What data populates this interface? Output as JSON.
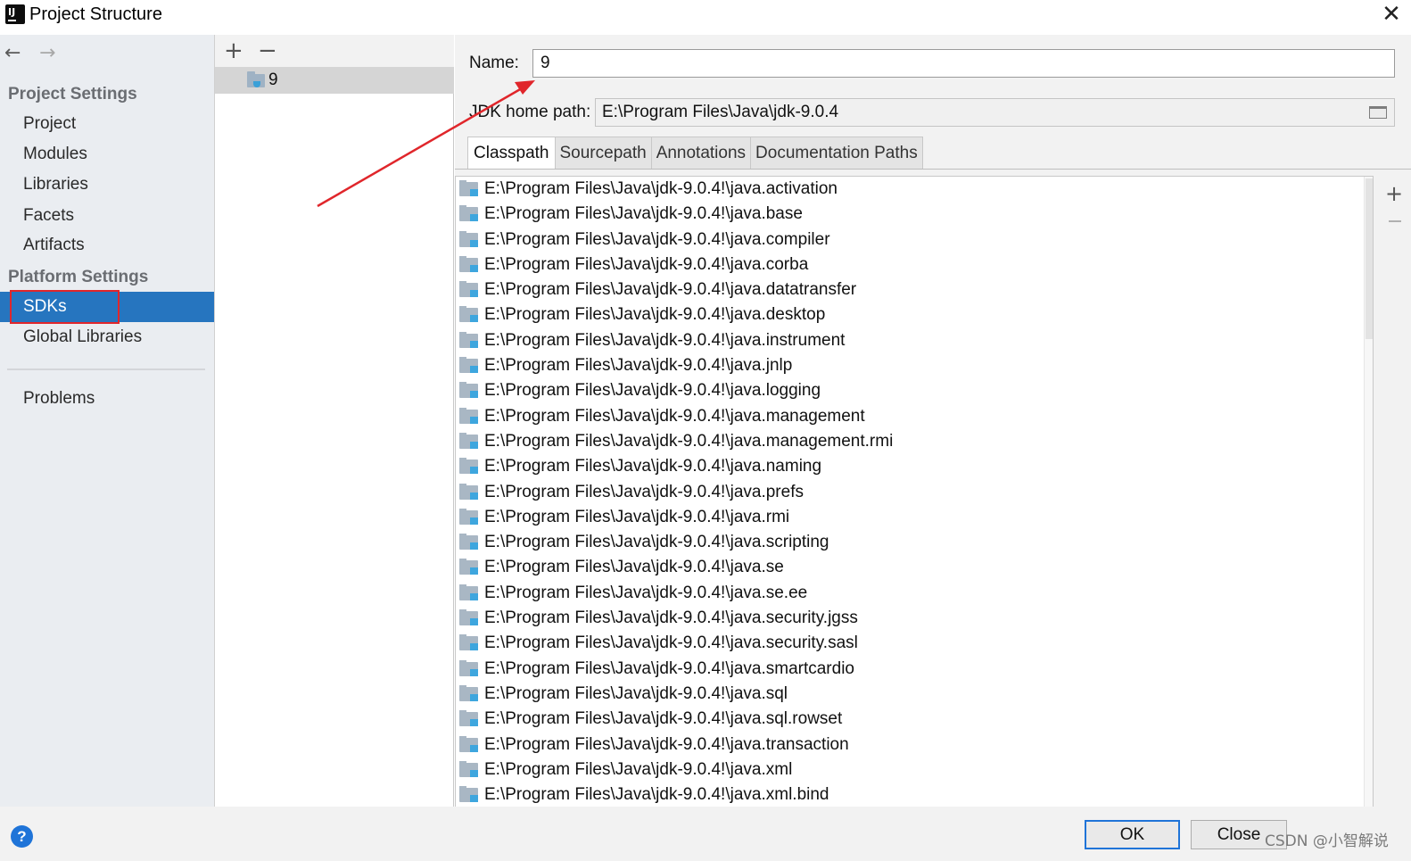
{
  "window": {
    "title": "Project Structure",
    "app_icon_letters": "IJ",
    "close_glyph": "✕"
  },
  "nav": {
    "back_glyph": "←",
    "forward_glyph": "→"
  },
  "sidebar": {
    "project_settings_header": "Project Settings",
    "project_items": [
      "Project",
      "Modules",
      "Libraries",
      "Facets",
      "Artifacts"
    ],
    "platform_settings_header": "Platform Settings",
    "platform_items": [
      "SDKs",
      "Global Libraries"
    ],
    "selected_item": "SDKs",
    "problems_label": "Problems"
  },
  "sdk_list": {
    "add_glyph": "+",
    "remove_glyph": "−",
    "items": [
      "9"
    ]
  },
  "details": {
    "name_label": "Name:",
    "name_value": "9",
    "jdk_path_label": "JDK home path:",
    "jdk_path_value": "E:\\Program Files\\Java\\jdk-9.0.4",
    "tabs": [
      "Classpath",
      "Sourcepath",
      "Annotations",
      "Documentation Paths"
    ],
    "active_tab": "Classpath",
    "side_add_glyph": "+",
    "classpath_entries": [
      "E:\\Program Files\\Java\\jdk-9.0.4!\\java.activation",
      "E:\\Program Files\\Java\\jdk-9.0.4!\\java.base",
      "E:\\Program Files\\Java\\jdk-9.0.4!\\java.compiler",
      "E:\\Program Files\\Java\\jdk-9.0.4!\\java.corba",
      "E:\\Program Files\\Java\\jdk-9.0.4!\\java.datatransfer",
      "E:\\Program Files\\Java\\jdk-9.0.4!\\java.desktop",
      "E:\\Program Files\\Java\\jdk-9.0.4!\\java.instrument",
      "E:\\Program Files\\Java\\jdk-9.0.4!\\java.jnlp",
      "E:\\Program Files\\Java\\jdk-9.0.4!\\java.logging",
      "E:\\Program Files\\Java\\jdk-9.0.4!\\java.management",
      "E:\\Program Files\\Java\\jdk-9.0.4!\\java.management.rmi",
      "E:\\Program Files\\Java\\jdk-9.0.4!\\java.naming",
      "E:\\Program Files\\Java\\jdk-9.0.4!\\java.prefs",
      "E:\\Program Files\\Java\\jdk-9.0.4!\\java.rmi",
      "E:\\Program Files\\Java\\jdk-9.0.4!\\java.scripting",
      "E:\\Program Files\\Java\\jdk-9.0.4!\\java.se",
      "E:\\Program Files\\Java\\jdk-9.0.4!\\java.se.ee",
      "E:\\Program Files\\Java\\jdk-9.0.4!\\java.security.jgss",
      "E:\\Program Files\\Java\\jdk-9.0.4!\\java.security.sasl",
      "E:\\Program Files\\Java\\jdk-9.0.4!\\java.smartcardio",
      "E:\\Program Files\\Java\\jdk-9.0.4!\\java.sql",
      "E:\\Program Files\\Java\\jdk-9.0.4!\\java.sql.rowset",
      "E:\\Program Files\\Java\\jdk-9.0.4!\\java.transaction",
      "E:\\Program Files\\Java\\jdk-9.0.4!\\java.xml",
      "E:\\Program Files\\Java\\jdk-9.0.4!\\java.xml.bind"
    ]
  },
  "footer": {
    "help_glyph": "?",
    "ok_label": "OK",
    "close_label": "Close",
    "watermark": "CSDN @小智解说"
  },
  "colors": {
    "selection": "#2675bf",
    "annotation_red": "#e0262b",
    "sidebar_bg": "#eaedf1",
    "primary_button_border": "#1f74d8"
  },
  "icons": {
    "app": "intellij-idea-icon",
    "folder": "sdk-folder-icon",
    "jar": "jar-library-icon",
    "browse": "folder-open-icon",
    "help": "help-icon"
  }
}
